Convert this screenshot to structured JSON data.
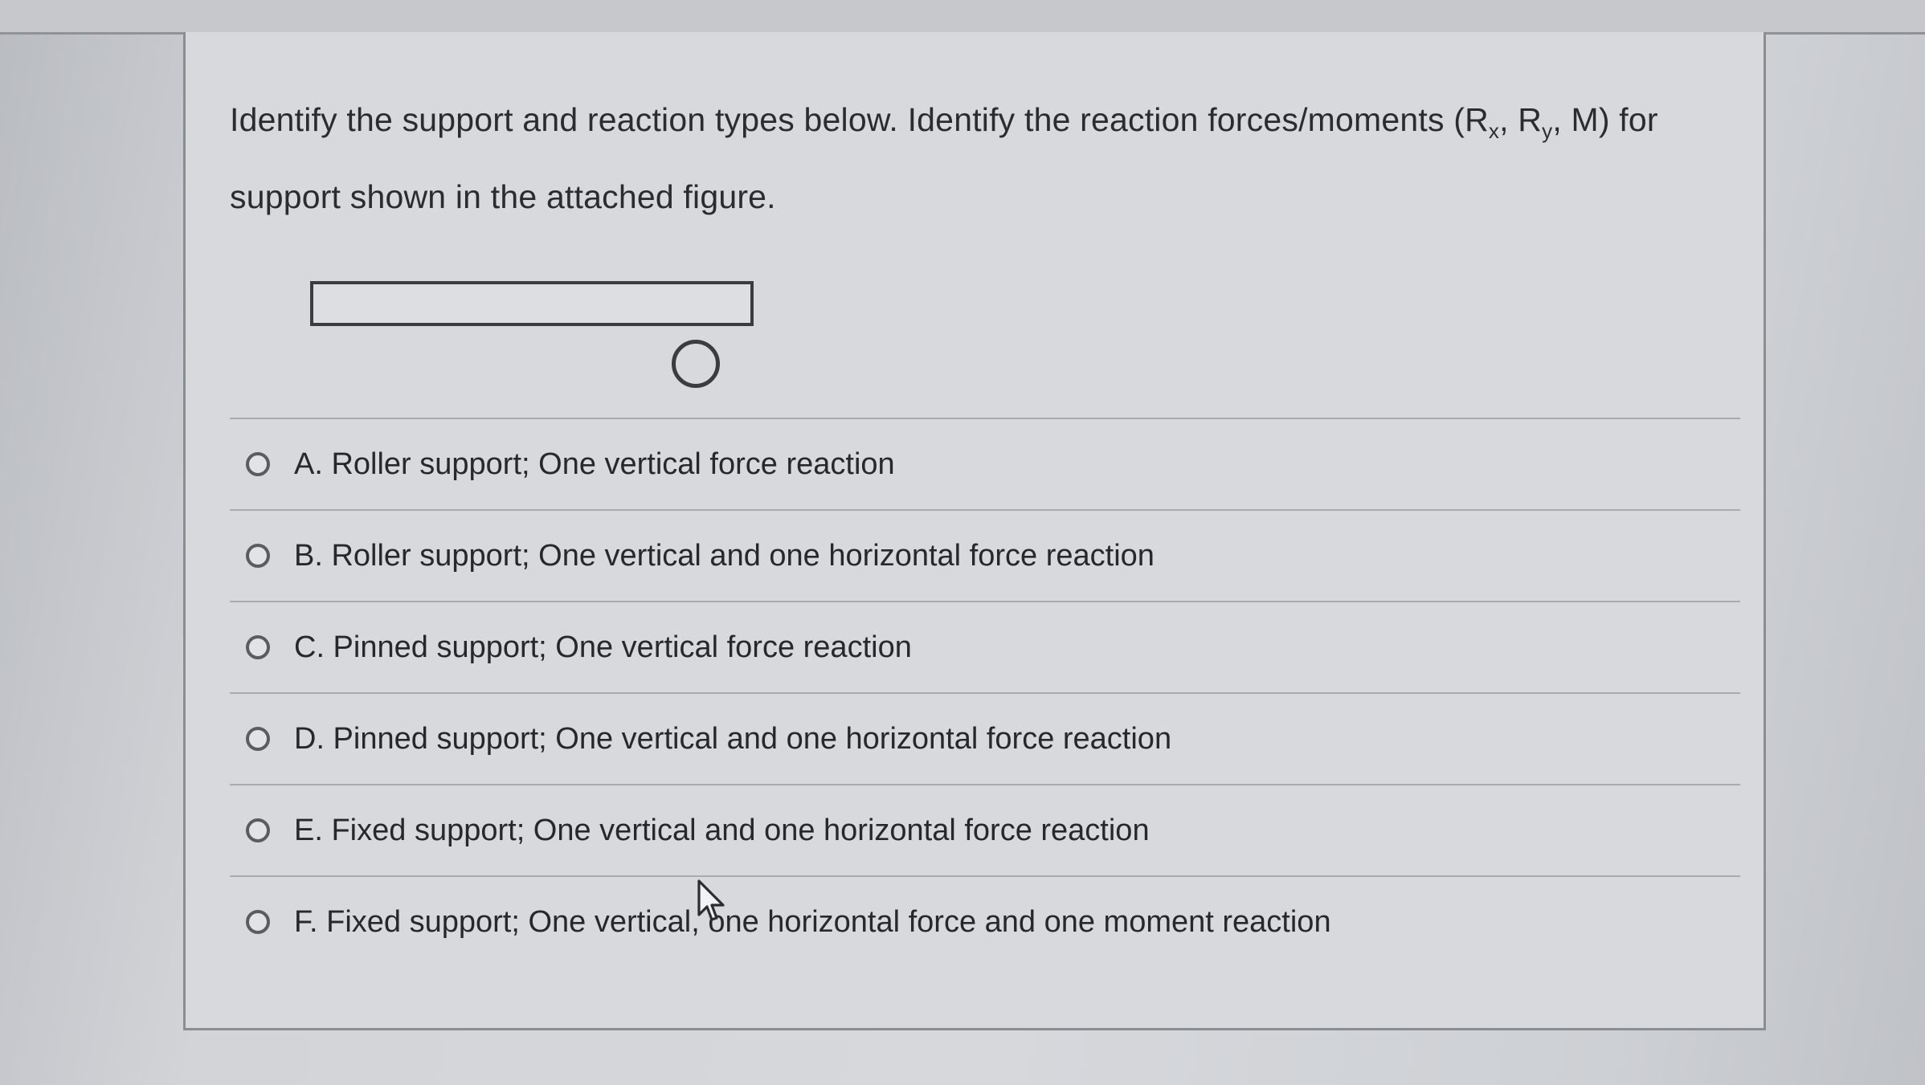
{
  "question": {
    "line1": "Identify the support and reaction types below. Identify the reaction forces/moments (R",
    "sub_x": "x",
    "sep1": ", R",
    "sub_y": "y",
    "line1_end": ", M) for",
    "line2": "support shown in the attached figure."
  },
  "options": [
    {
      "label": "A. Roller support; One vertical force reaction"
    },
    {
      "label": "B. Roller support; One vertical and one horizontal force reaction"
    },
    {
      "label": "C. Pinned support; One vertical force reaction"
    },
    {
      "label": "D. Pinned support; One vertical and one horizontal force reaction"
    },
    {
      "label": "E. Fixed support; One vertical and one horizontal force reaction"
    },
    {
      "label": "F. Fixed support; One vertical, one horizontal force and one moment reaction"
    }
  ],
  "cursor_icon": "mouse-pointer-icon"
}
